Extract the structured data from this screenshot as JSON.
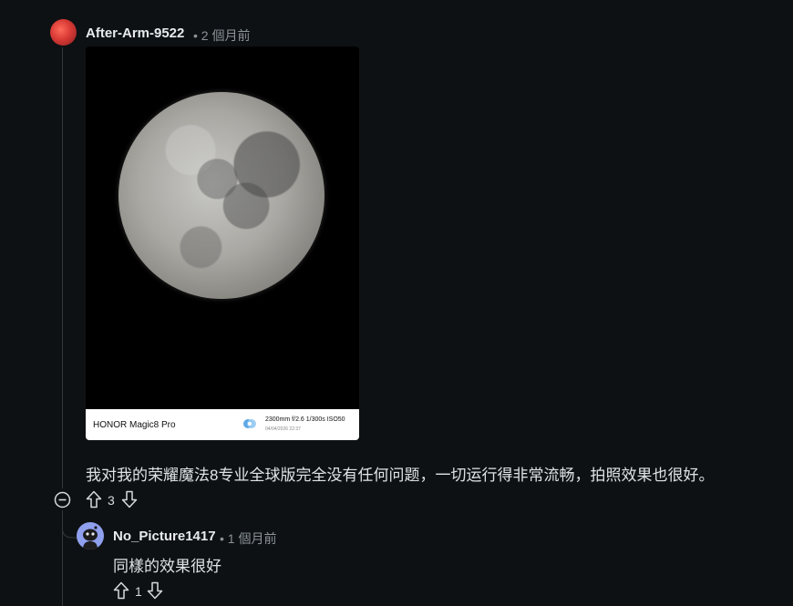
{
  "comment": {
    "author": "After-Arm-9522",
    "time": "• 2 個月前",
    "photo": {
      "device": "HONOR Magic8 Pro",
      "specs": "2300mm  f/2.6  1/300s  ISO50",
      "date": "04/04/2026 22:37"
    },
    "body": "我对我的荣耀魔法8专业全球版完全没有任何问题，一切运行得非常流畅，拍照效果也很好。",
    "votes": "3"
  },
  "reply": {
    "author": "No_Picture1417",
    "time": "• 1 個月前",
    "body": "同樣的效果很好",
    "votes": "1"
  },
  "colors": {
    "background": "#0e1113",
    "thread_line": "#33383b",
    "avatar_red": "#d83a35",
    "avatar_blue": "#8fa0ef"
  }
}
